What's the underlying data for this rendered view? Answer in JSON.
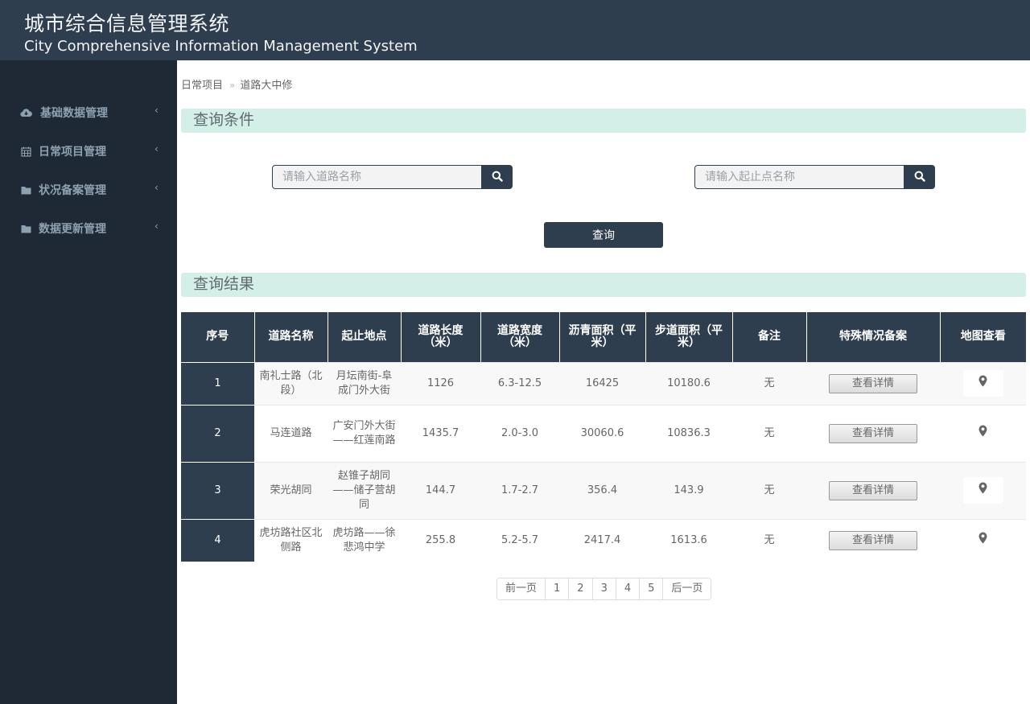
{
  "header": {
    "title_cn": "城市综合信息管理系统",
    "title_en": "City Comprehensive Information Management System"
  },
  "sidebar": {
    "items": [
      {
        "label": "基础数据管理",
        "icon": "cloud-download-icon"
      },
      {
        "label": "日常项目管理",
        "icon": "calendar-icon"
      },
      {
        "label": "状况备案管理",
        "icon": "folder-icon"
      },
      {
        "label": "数据更新管理",
        "icon": "folder-icon"
      }
    ],
    "chevron": "‹"
  },
  "breadcrumb": {
    "items": [
      "日常项目",
      "道路大中修"
    ],
    "separator": "»"
  },
  "query_section": {
    "title": "查询条件",
    "road_name_placeholder": "请输入道路名称",
    "endpoints_placeholder": "请输入起止点名称",
    "query_button": "查询"
  },
  "results_section": {
    "title": "查询结果",
    "columns": [
      "序号",
      "道路名称",
      "起止地点",
      "道路长度（米）",
      "道路宽度（米）",
      "沥青面积（平米）",
      "步道面积（平米）",
      "备注",
      "特殊情况备案",
      "地图查看"
    ],
    "rows": [
      {
        "index": "1",
        "road_name": "南礼士路（北段）",
        "endpoints": "月坛南街-阜成门外大街",
        "length": "1126",
        "width": "6.3-12.5",
        "asphalt_area": "16425",
        "sidewalk_area": "10180.6",
        "remark": "无",
        "detail_button": "查看详情"
      },
      {
        "index": "2",
        "road_name": "马连道路",
        "endpoints": "广安门外大街——红莲南路",
        "length": "1435.7",
        "width": "2.0-3.0",
        "asphalt_area": "30060.6",
        "sidewalk_area": "10836.3",
        "remark": "无",
        "detail_button": "查看详情"
      },
      {
        "index": "3",
        "road_name": "荣光胡同",
        "endpoints": "赵锥子胡同——储子营胡同",
        "length": "144.7",
        "width": "1.7-2.7",
        "asphalt_area": "356.4",
        "sidewalk_area": "143.9",
        "remark": "无",
        "detail_button": "查看详情"
      },
      {
        "index": "4",
        "road_name": "虎坊路社区北侧路",
        "endpoints": "虎坊路——徐悲鸿中学",
        "length": "255.8",
        "width": "5.2-5.7",
        "asphalt_area": "2417.4",
        "sidewalk_area": "1613.6",
        "remark": "无",
        "detail_button": "查看详情"
      }
    ]
  },
  "pagination": {
    "prev": "前一页",
    "pages": [
      "1",
      "2",
      "3",
      "4",
      "5"
    ],
    "next": "后一页"
  },
  "colors": {
    "primary": "#2e3e4f",
    "sidebar_bg": "#1e2935",
    "section_bar": "#d3efe7"
  }
}
